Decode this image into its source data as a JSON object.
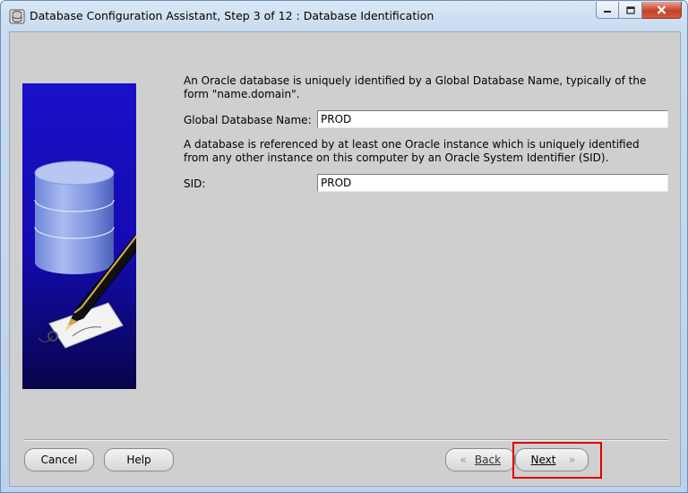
{
  "window": {
    "title": "Database Configuration Assistant, Step 3 of 12 : Database Identification",
    "icon": "database-app-icon",
    "controls": [
      "minimize-icon",
      "maximize-icon",
      "close-icon"
    ]
  },
  "main": {
    "intro_text": "An Oracle database is uniquely identified by a Global Database Name, typically of the form \"name.domain\".",
    "global_db_label": "Global Database Name:",
    "global_db_value": "PROD",
    "sid_intro_text": "A database is referenced by at least one Oracle instance which is uniquely identified from any other instance on this computer by an Oracle System Identifier (SID).",
    "sid_label": "SID:",
    "sid_value": "PROD"
  },
  "footer": {
    "cancel_label": "Cancel",
    "help_label": "Help",
    "back_label": "Back",
    "next_label": "Next",
    "highlight_color": "#e00000"
  },
  "colors": {
    "client_bg": "#cfcfcf",
    "banner_blue": "#1a10c8"
  }
}
